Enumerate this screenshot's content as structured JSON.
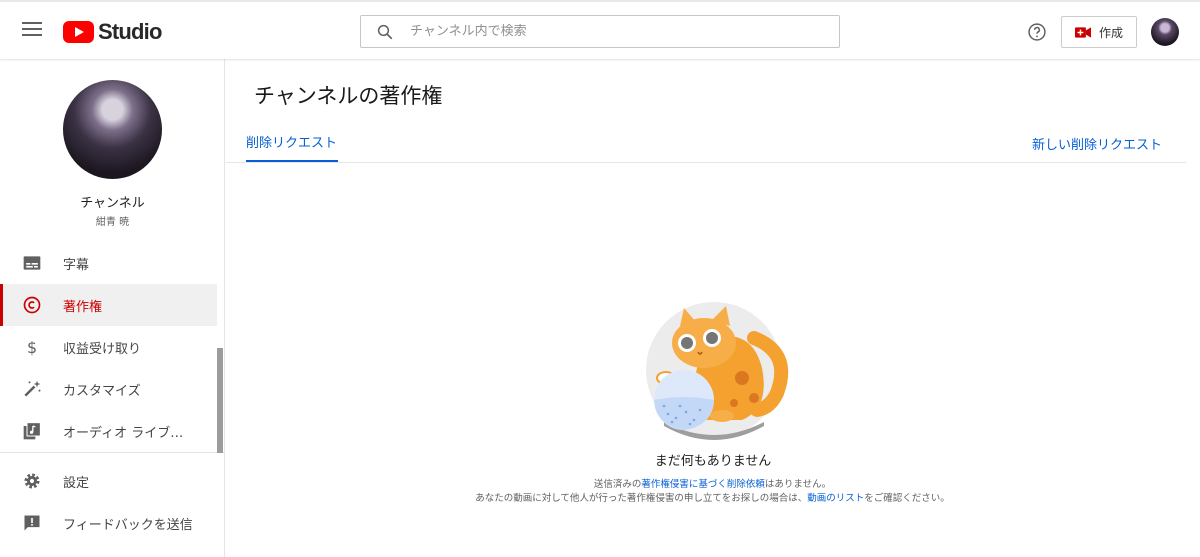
{
  "header": {
    "logo_text": "Studio",
    "search_placeholder": "チャンネル内で検索",
    "create_label": "作成"
  },
  "sidebar": {
    "channel_title": "チャンネル",
    "channel_name": "紺青 暁",
    "items": [
      {
        "label": "字幕",
        "icon": "subtitles-icon"
      },
      {
        "label": "著作権",
        "icon": "copyright-icon",
        "active": true
      },
      {
        "label": "収益受け取り",
        "icon": "dollar-icon"
      },
      {
        "label": "カスタマイズ",
        "icon": "magic-wand-icon"
      },
      {
        "label": "オーディオ ライブ…",
        "icon": "audio-library-icon"
      },
      {
        "label": "設定",
        "icon": "gear-icon"
      },
      {
        "label": "フィードバックを送信",
        "icon": "feedback-icon"
      }
    ]
  },
  "main": {
    "page_title": "チャンネルの著作権",
    "tab_label": "削除リクエスト",
    "new_request_label": "新しい削除リクエスト",
    "empty_title": "まだ何もありません",
    "empty_line1_prefix": "送信済みの",
    "empty_line1_link": "著作権侵害に基づく削除依頼",
    "empty_line1_suffix": "はありません。",
    "empty_line2_prefix": "あなたの動画に対して他人が行った著作権侵害の申し立てをお探しの場合は、",
    "empty_line2_link": "動画のリスト",
    "empty_line2_suffix": "をご確認ください。"
  },
  "colors": {
    "accent_blue": "#065fd4",
    "active_red": "#cc0000",
    "brand_red": "#ff0000"
  }
}
